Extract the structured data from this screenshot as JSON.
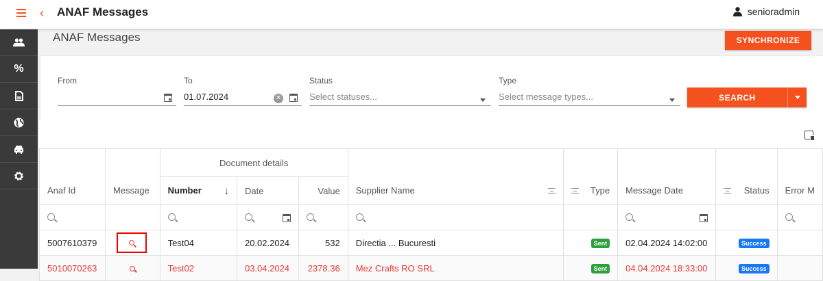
{
  "app": {
    "title": "ANAF Messages",
    "user": "senioradmin"
  },
  "sidebar": {
    "items": [
      {
        "icon": "users-icon"
      },
      {
        "icon": "percent-icon"
      },
      {
        "icon": "document-icon"
      },
      {
        "icon": "globe-icon"
      },
      {
        "icon": "car-icon"
      },
      {
        "icon": "gear-icon"
      }
    ]
  },
  "page": {
    "title": "ANAF Messages",
    "sync_label": "SYNCHRONIZE"
  },
  "filters": {
    "from_label": "From",
    "from_value": "",
    "to_label": "To",
    "to_value": "01.07.2024",
    "status_label": "Status",
    "status_placeholder": "Select statuses...",
    "type_label": "Type",
    "type_placeholder": "Select message types...",
    "search_label": "SEARCH"
  },
  "grid": {
    "group_header": "Document details",
    "columns": {
      "anaf_id": "Anaf Id",
      "message": "Message",
      "number": "Number",
      "date": "Date",
      "value": "Value",
      "supplier": "Supplier Name",
      "type": "Type",
      "message_date": "Message Date",
      "status": "Status",
      "error": "Error M"
    },
    "rows": [
      {
        "anaf_id": "5007610379",
        "number": "Test04",
        "date": "20.02.2024",
        "value": "532",
        "supplier": "Directia ... Bucuresti",
        "type": "Sent",
        "message_date": "02.04.2024 14:02:00",
        "status": "Success"
      },
      {
        "anaf_id": "5010070263",
        "number": "Test02",
        "date": "03.04.2024",
        "value": "2378.36",
        "supplier": "Mez Crafts RO SRL",
        "type": "Sent",
        "message_date": "04.04.2024 18:33:00",
        "status": "Success"
      }
    ]
  }
}
